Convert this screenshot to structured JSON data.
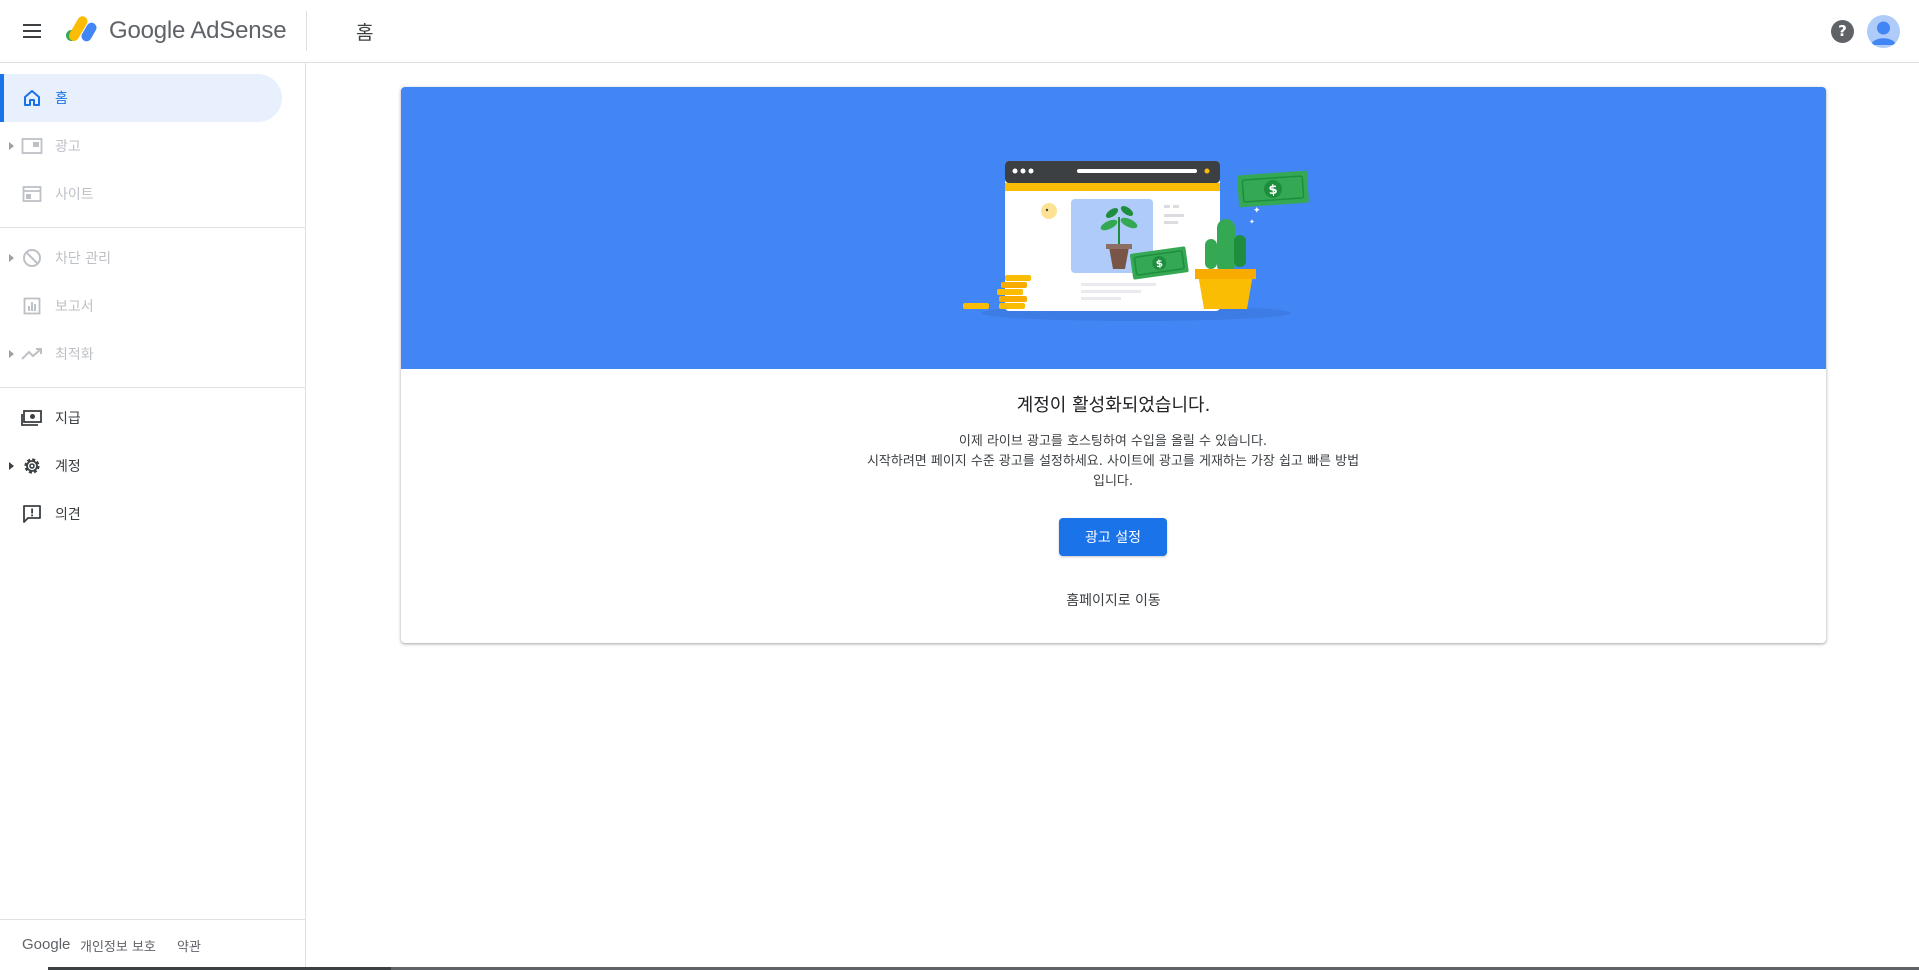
{
  "header": {
    "logo_text": "Google AdSense",
    "page_title": "홈",
    "help_symbol": "?"
  },
  "sidebar": {
    "items": [
      {
        "label": "홈",
        "icon": "home-icon",
        "state": "active"
      },
      {
        "label": "광고",
        "icon": "ads-icon",
        "state": "disabled"
      },
      {
        "label": "사이트",
        "icon": "sites-icon",
        "state": "disabled"
      },
      {
        "label": "차단 관리",
        "icon": "block-icon",
        "state": "disabled"
      },
      {
        "label": "보고서",
        "icon": "reports-icon",
        "state": "disabled"
      },
      {
        "label": "최적화",
        "icon": "optimize-icon",
        "state": "disabled"
      },
      {
        "label": "지급",
        "icon": "payments-icon",
        "state": "enabled"
      },
      {
        "label": "계정",
        "icon": "gear-icon",
        "state": "enabled"
      },
      {
        "label": "의견",
        "icon": "feedback-icon",
        "state": "enabled"
      }
    ],
    "footer": {
      "google": "Google",
      "privacy": "개인정보 보호",
      "terms": "약관"
    }
  },
  "main": {
    "title": "계정이 활성화되었습니다.",
    "desc_line1": "이제 라이브 광고를 호스팅하여 수입을 올릴 수 있습니다.",
    "desc_line2": "시작하려면 페이지 수준 광고를 설정하세요. 사이트에 광고를 게재하는 가장 쉽고 빠른 방법입니다.",
    "setup_button": "광고 설정",
    "home_link": "홈페이지로 이동",
    "dollar_symbol": "$"
  },
  "colors": {
    "accent": "#1a73e8",
    "hero_bg": "#4285f4",
    "active_bg": "#e8f0fe",
    "disabled_text": "#bdc1c6"
  }
}
